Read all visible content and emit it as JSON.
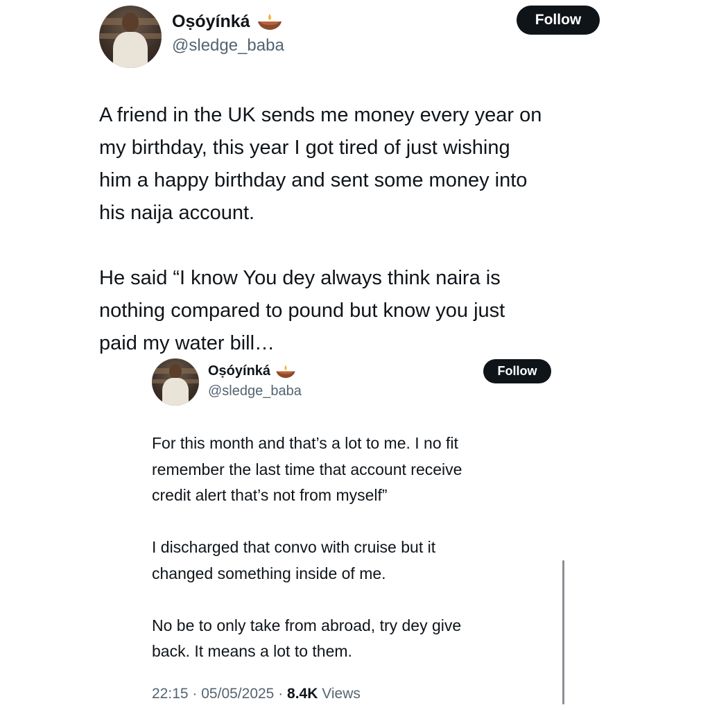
{
  "main_tweet": {
    "display_name": "Oṣóyínká",
    "handle": "@sledge_baba",
    "follow_label": "Follow",
    "name_emoji": "diya-lamp-icon",
    "text": "A friend in the UK sends me money every year on\nmy birthday, this year I got tired of just wishing\nhim a happy birthday and sent some money into\nhis naija account.\n\nHe said “I know You dey always think naira is\nnothing compared to pound but know you just\npaid my water bill…"
  },
  "quoted_tweet": {
    "display_name": "Oṣóyínká",
    "handle": "@sledge_baba",
    "follow_label": "Follow",
    "name_emoji": "diya-lamp-icon",
    "text": "For this month and that’s a lot to me. I no fit\nremember the last time that account receive\ncredit alert that’s not from myself”\n\nI discharged that convo with cruise but it\nchanged something inside of me.\n\nNo be to only take from abroad, try dey give\nback. It means a lot to them.",
    "time": "22:15",
    "date": "05/05/2025",
    "views_count": "8.4K",
    "views_label": "Views",
    "separator": "·"
  },
  "colors": {
    "text": "#0f1419",
    "secondary": "#536471",
    "button_bg": "#0f1419",
    "button_text": "#ffffff"
  }
}
